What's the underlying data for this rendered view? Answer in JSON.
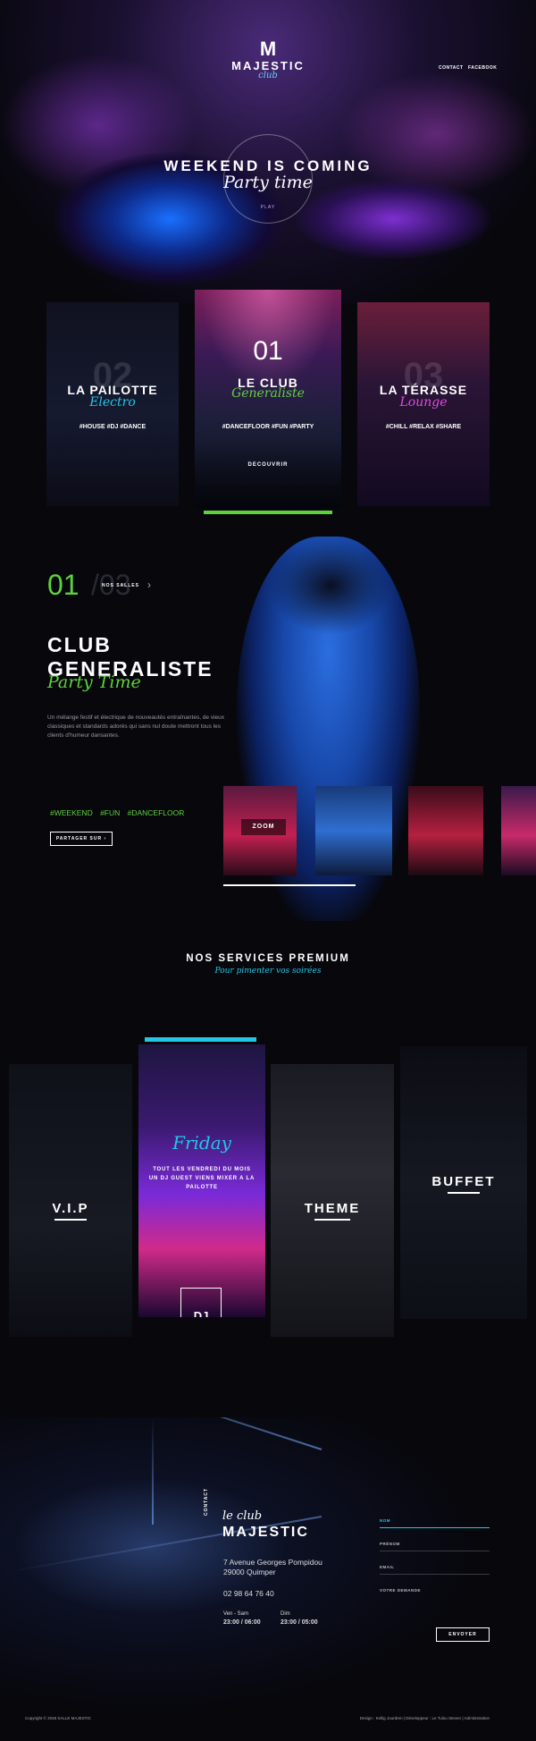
{
  "header": {
    "logo_mark": "M",
    "logo_name": "MAJESTIC",
    "logo_club": "club",
    "nav": [
      {
        "label": "CONTACT"
      },
      {
        "label": "FACEBOOK"
      }
    ]
  },
  "hero": {
    "title": "WEEKEND IS COMING",
    "subtitle": "Party time",
    "play_label": "PLAY"
  },
  "rooms": [
    {
      "num": "02",
      "title": "LA PAILOTTE",
      "subtitle": "Electro",
      "tags": "#HOUSE  #DJ  #DANCE",
      "accent": "#22c7e6"
    },
    {
      "num": "01",
      "title": "LE CLUB",
      "subtitle": "Generaliste",
      "tags": "#DANCEFLOOR  #FUN  #PARTY",
      "cta": "DECOUVRIR",
      "accent": "#5ed23b"
    },
    {
      "num": "03",
      "title": "LA TÉRASSE",
      "subtitle": "Lounge",
      "tags": "#CHILL  #RELAX  #SHARE",
      "accent": "#e04adf"
    }
  ],
  "club": {
    "counter": "01",
    "counter_total": "/03",
    "salles_label": "NOS SALLES",
    "title_line1": "CLUB",
    "title_line2": "GENERALISTE",
    "subtitle": "Party Time",
    "description": "Un mélange festif et électrique de nouveautés entraînantes, de vieux classiques et standards adorés qui sans nul doute mettront tous les clients d'humeur dansantes.",
    "tags": "#WEEKEND  #FUN  #DANCEFLOOR",
    "share_label": "PARTAGER SUR ›",
    "zoom_label": "ZOOM"
  },
  "services": {
    "title": "NOS SERVICES PREMIUM",
    "subtitle": "Pour pimenter vos soirées",
    "items": [
      {
        "label": "V.I.P"
      },
      {
        "label": "DJ",
        "day": "Friday",
        "description": "TOUT LES VENDREDI DU MOIS UN DJ GUEST VIENS MIXER A LA PAILOTTE"
      },
      {
        "label": "THEME"
      },
      {
        "label": "BUFFET"
      }
    ],
    "accent": "#22c7e6"
  },
  "contact": {
    "vertical_label": "CONTACT",
    "le_club": "le club",
    "name": "MAJESTIC",
    "address_line1": "7 Avenue Georges Pompidou",
    "address_line2": "29000 Quimper",
    "phone": "02 98 64 76 40",
    "hours": [
      {
        "days": "Ven - Sam",
        "time": "23:00 / 06:00"
      },
      {
        "days": "Dim",
        "time": "23:00 / 05:00"
      }
    ],
    "form": {
      "nom_label": "NOM",
      "prenom_label": "PRÉNOM",
      "email_label": "EMAIL",
      "demande_label": "VOTRE DEMANDE",
      "send_label": "ENVOYER"
    }
  },
  "footer": {
    "copyright": "Copyright © 2048 SALLE MAJESTIC",
    "credits": "Design : Kellig Jourdren | Développeur : Le Tulou Steven | Administration"
  }
}
